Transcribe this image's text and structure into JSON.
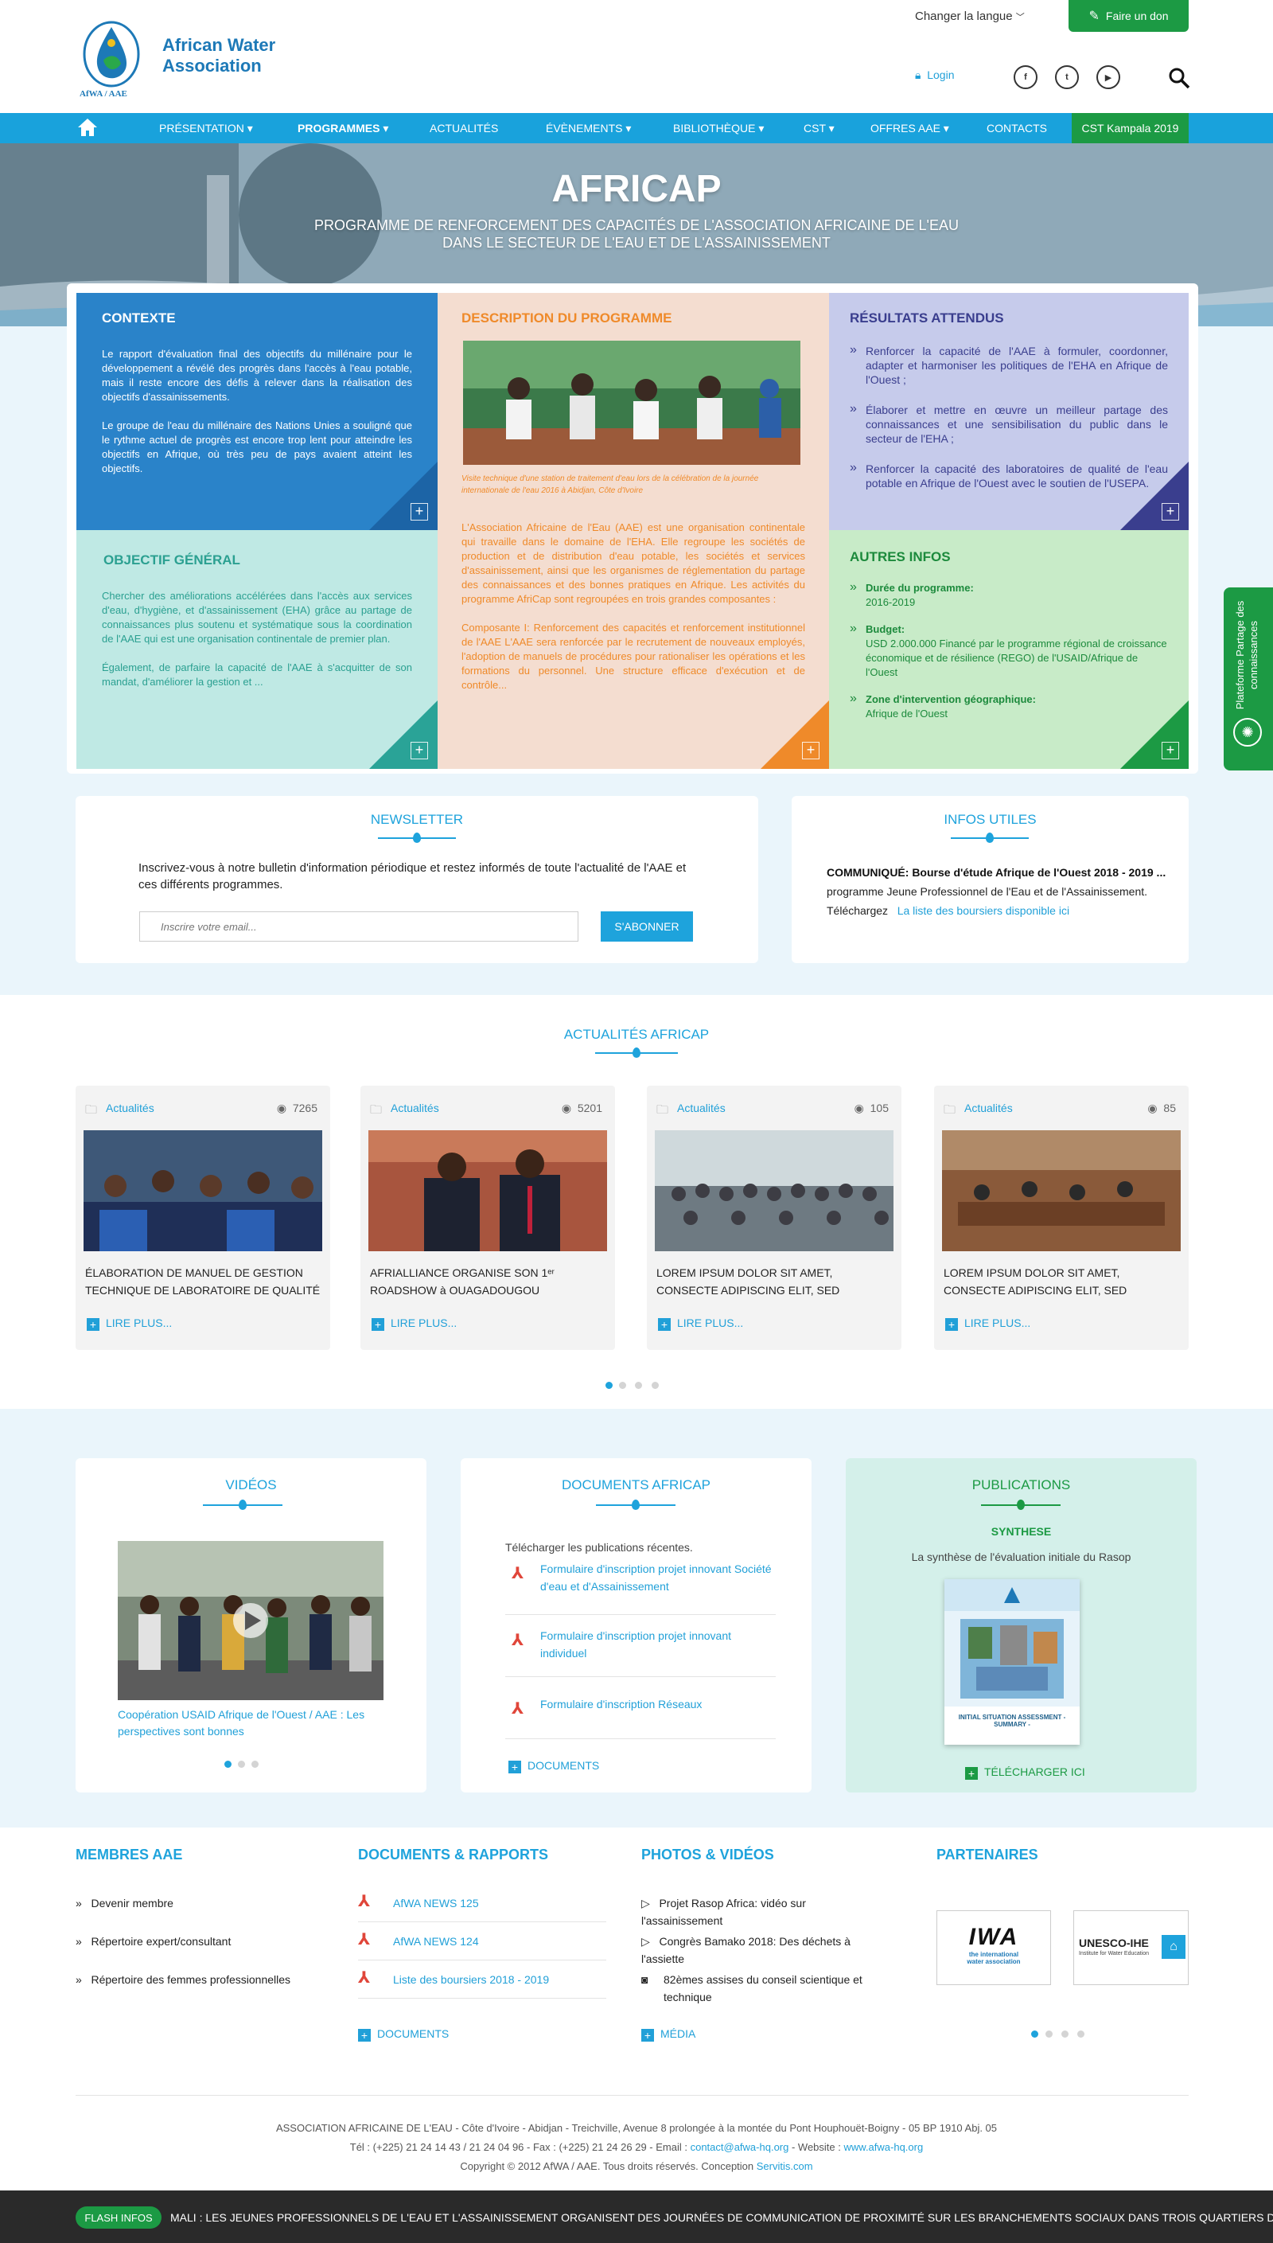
{
  "header": {
    "org_line1": "African Water",
    "org_line2": "Association",
    "logo_caption": "AfWA / AAE",
    "lang": "Changer la langue",
    "donate": "Faire un don",
    "login": "Login"
  },
  "nav": {
    "items": [
      "PRÉSENTATION",
      "PROGRAMMES",
      "ACTUALITÉS",
      "ÉVÈNEMENTS",
      "BIBLIOTHÈQUE",
      "CST",
      "OFFRES AAE",
      "CONTACTS"
    ],
    "cst": "CST Kampala 2019"
  },
  "hero": {
    "title": "AFRICAP",
    "subtitle": "PROGRAMME DE RENFORCEMENT DES CAPACITÉS DE L'ASSOCIATION AFRICAINE DE L'EAU DANS LE SECTEUR DE L'EAU ET DE L'ASSAINISSEMENT"
  },
  "contexte": {
    "title": "CONTEXTE",
    "p1": "Le rapport d'évaluation final des objectifs du millénaire pour le développement a révélé des progrès dans l'accès à l'eau potable, mais il reste encore des défis à relever dans la réalisation des objectifs d'assainissements.",
    "p2": "Le groupe de l'eau du millénaire des Nations Unies a souligné que le rythme actuel de progrès est encore trop lent pour atteindre les objectifs en Afrique, où très peu de pays avaient atteint les objectifs."
  },
  "objectif": {
    "title": "OBJECTIF GÉNÉRAL",
    "p1": "Chercher des améliorations accélérées dans l'accès aux services d'eau, d'hygiène, et d'assainissement (EHA) grâce au partage de connaissances plus soutenu et systématique sous la coordination de l'AAE qui est une organisation continentale de premier plan.",
    "p2": "Également, de parfaire la capacité de l'AAE à s'acquitter de son mandat, d'améliorer la gestion et ..."
  },
  "description": {
    "title": "DESCRIPTION DU PROGRAMME",
    "caption": "Visite technique d'une station de traitement d'eau lors de la célébration de la journée internationale de l'eau 2016 à Abidjan, Côte d'Ivoire",
    "p1": "L'Association Africaine de l'Eau (AAE) est une organisation continentale qui travaille dans le domaine de l'EHA. Elle regroupe les sociétés de production et de distribution d'eau potable, les sociétés et services d'assainissement, ainsi que les organismes de réglementation du partage des connaissances et des bonnes pratiques en Afrique. Les activités du programme AfriCap sont regroupées en trois grandes composantes :",
    "p2": "Composante I: Renforcement des capacités et renforcement institutionnel de l'AAE L'AAE sera renforcée par le recrutement de nouveaux employés, l'adoption de manuels de procédures pour rationaliser les opérations et les formations du personnel. Une structure efficace d'exécution et de contrôle..."
  },
  "resultats": {
    "title": "RÉSULTATS ATTENDUS",
    "items": [
      "Renforcer la capacité de l'AAE à formuler, coordonner, adapter et harmoniser les politiques de l'EHA en Afrique de l'Ouest ;",
      "Élaborer et mettre en œuvre un meilleur partage des connaissances et une sensibilisation du public dans le secteur de l'EHA ;",
      "Renforcer la capacité des laboratoires de qualité de l'eau potable en Afrique de l'Ouest avec le soutien de l'USEPA."
    ]
  },
  "autres": {
    "title": "AUTRES INFOS",
    "items": [
      {
        "label": "Durée du programme:",
        "value": "2016-2019"
      },
      {
        "label": "Budget:",
        "value": "USD 2.000.000 Financé par le programme régional de croissance économique et de résilience (REGO) de l'USAID/Afrique de l'Ouest"
      },
      {
        "label": "Zone d'intervention géographique:",
        "value": "Afrique de l'Ouest"
      }
    ]
  },
  "newsletter": {
    "title": "NEWSLETTER",
    "text": "Inscrivez-vous à notre bulletin d'information périodique et restez informés de toute l'actualité de l'AAE et ces différents programmes.",
    "placeholder": "Inscrire votre email...",
    "button": "S'ABONNER"
  },
  "infos": {
    "title": "INFOS UTILES",
    "headline": "COMMUNIQUÉ: Bourse d'étude Afrique de l'Ouest 2018 - 2019 ...",
    "line2": "programme Jeune Professionnel de l'Eau et de l'Assainissement.",
    "line3": "Téléchargez",
    "link": "La liste des boursiers disponible ici"
  },
  "actualites": {
    "title": "ACTUALITÉS AFRICAP",
    "items": [
      {
        "cat": "Actualités",
        "views": "7265",
        "title": "ÉLABORATION DE MANUEL DE GESTION TECHNIQUE DE LABORATOIRE DE QUALITÉ",
        "more": "LIRE PLUS..."
      },
      {
        "cat": "Actualités",
        "views": "5201",
        "title": "AFRIALLIANCE ORGANISE SON 1ᵉʳ ROADSHOW à OUAGADOUGOU",
        "more": "LIRE PLUS..."
      },
      {
        "cat": "Actualités",
        "views": "105",
        "title": "LOREM IPSUM DOLOR SIT AMET, CONSECTE ADIPISCING ELIT, SED",
        "more": "LIRE PLUS..."
      },
      {
        "cat": "Actualités",
        "views": "85",
        "title": "LOREM IPSUM DOLOR SIT AMET, CONSECTE ADIPISCING ELIT, SED",
        "more": "LIRE PLUS..."
      }
    ]
  },
  "videos": {
    "title": "VIDÉOS",
    "caption": "Coopération USAID Afrique de l'Ouest / AAE : Les perspectives sont bonnes"
  },
  "documents": {
    "title": "DOCUMENTS AFRICAP",
    "intro": "Télécharger les publications récentes.",
    "items": [
      "Formulaire d'inscription projet innovant Société d'eau et d'Assainissement",
      "Formulaire d'inscription projet innovant individuel",
      "Formulaire d'inscription Réseaux"
    ],
    "more": "DOCUMENTS"
  },
  "publications": {
    "title": "PUBLICATIONS",
    "subtitle": "SYNTHESE",
    "text": "La synthèse de l'évaluation initiale du Rasop",
    "cover_label": "INITIAL SITUATION ASSESSMENT - SUMMARY -",
    "more": "TÉLÉCHARGER ICI"
  },
  "footer": {
    "membres": {
      "title": "MEMBRES AAE",
      "items": [
        "Devenir membre",
        "Répertoire expert/consultant",
        "Répertoire des femmes professionnelles"
      ]
    },
    "docs": {
      "title": "DOCUMENTS & RAPPORTS",
      "items": [
        "AfWA NEWS 125",
        "AfWA NEWS 124",
        "Liste des boursiers 2018 - 2019"
      ],
      "more": "DOCUMENTS"
    },
    "media": {
      "title": "PHOTOS & VIDÉOS",
      "items": [
        "Projet Rasop Africa: vidéo sur l'assainissement",
        "Congrès Bamako 2018: Des déchets à l'assiette",
        "82èmes assises du conseil scientique et technique"
      ],
      "more": "MÉDIA"
    },
    "partners": {
      "title": "PARTENAIRES",
      "iwa": "IWA",
      "iwa_sub": "the international water association",
      "unesco": "UNESCO-IHE",
      "unesco_sub": "Institute for Water Education"
    }
  },
  "bottom": {
    "address": "ASSOCIATION AFRICAINE DE L'EAU - Côte d'Ivoire - Abidjan - Treichville, Avenue 8 prolongée à la montée du Pont Houphouët-Boigny - 05 BP 1910 Abj. 05",
    "tel": "Tél : (+225) 21 24 14 43 / 21 24 04 96 - Fax : (+225) 21 24 26 29 - Email :",
    "email": "contact@afwa-hq.org",
    "website_label": " - Website :",
    "website": "www.afwa-hq.org",
    "copyright": "Copyright © 2012 AfWA / AAE. Tous droits réservés. Conception",
    "servitis": "Servitis.com"
  },
  "flash": {
    "label": "FLASH INFOS",
    "text": "MALI : LES JEUNES PROFESSIONNELS DE L'EAU ET L'ASSAINISSEMENT ORGANISENT DES JOURNÉES DE COMMUNICATION DE PROXIMITÉ SUR LES BRANCHEMENTS SOCIAUX DANS TROIS QUARTIERS DU DISTRICT DE BAMAKO"
  },
  "side_tab": {
    "text": "Plateforme Partage des connaissances"
  }
}
